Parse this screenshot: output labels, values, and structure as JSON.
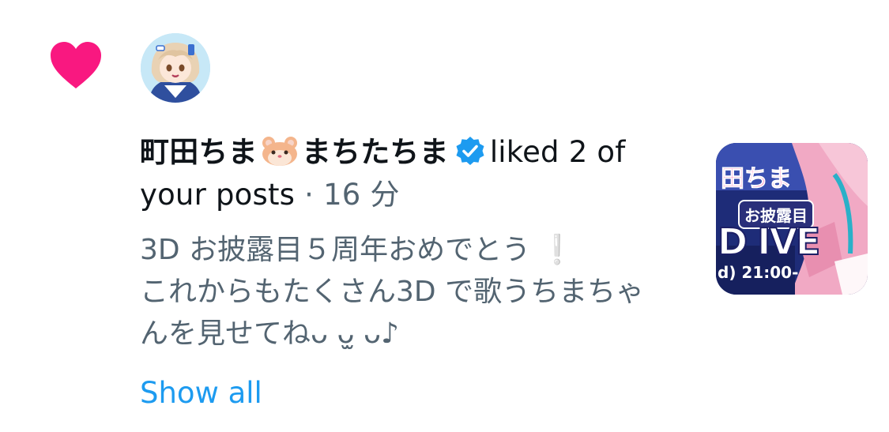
{
  "notification": {
    "type_icon": "heart-icon",
    "accent_color": "#f91880",
    "avatar_icon": "avatar-icon",
    "user_name_part1": "町田ちま",
    "user_emoji": "hamster-face-emoji",
    "user_name_part2": "まちたちま",
    "verified_icon": "verified-badge-icon",
    "verified_color": "#1d9bf0",
    "liked_text": "liked 2 of your posts",
    "separator": "·",
    "time_ago": "16 分",
    "post_text": "3D お披露目５周年おめでとう ❕\nこれからもたくさん3D で歌うちまちゃんを見せてね",
    "post_text_suffix": "ᴗ ᴗ̫ ᴗ♪",
    "show_all_label": "Show all",
    "show_all_color": "#1d9bf0",
    "media": {
      "name_text": "田ちま",
      "event_text": "お披露目",
      "big_text": "D IVE",
      "time_text": "d) 21:00-"
    }
  }
}
